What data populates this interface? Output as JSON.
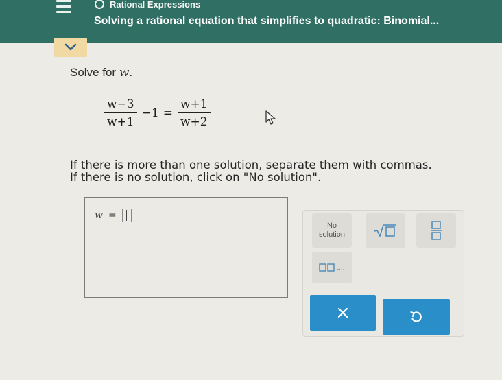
{
  "header": {
    "topic": "Rational Expressions",
    "title": "Solving a rational equation that simplifies to quadratic: Binomial..."
  },
  "problem": {
    "prompt": "Solve for",
    "variable": "w",
    "prompt_end": ".",
    "equation": {
      "lhs_num": "w−3",
      "lhs_den": "w+1",
      "minus_one": "−1",
      "equals": "=",
      "rhs_num": "w+1",
      "rhs_den": "w+2"
    },
    "instruction_1": "If there is more than one solution, separate them with commas.",
    "instruction_2": "If there is no solution, click on \"No solution\"."
  },
  "answer": {
    "variable": "w",
    "equals": "=",
    "value": ""
  },
  "keypad": {
    "no_solution_line1": "No",
    "no_solution_line2": "solution",
    "list_suffix": ",..."
  },
  "colors": {
    "header_bg": "#2f6f64",
    "collapse_bg": "#f1d9a4",
    "action_bg": "#2a8fc9"
  },
  "icons": [
    "menu-icon",
    "chevron-down-icon",
    "cursor-arrow-icon",
    "sqrt-icon",
    "fraction-icon",
    "list-icon",
    "close-icon",
    "undo-icon"
  ]
}
